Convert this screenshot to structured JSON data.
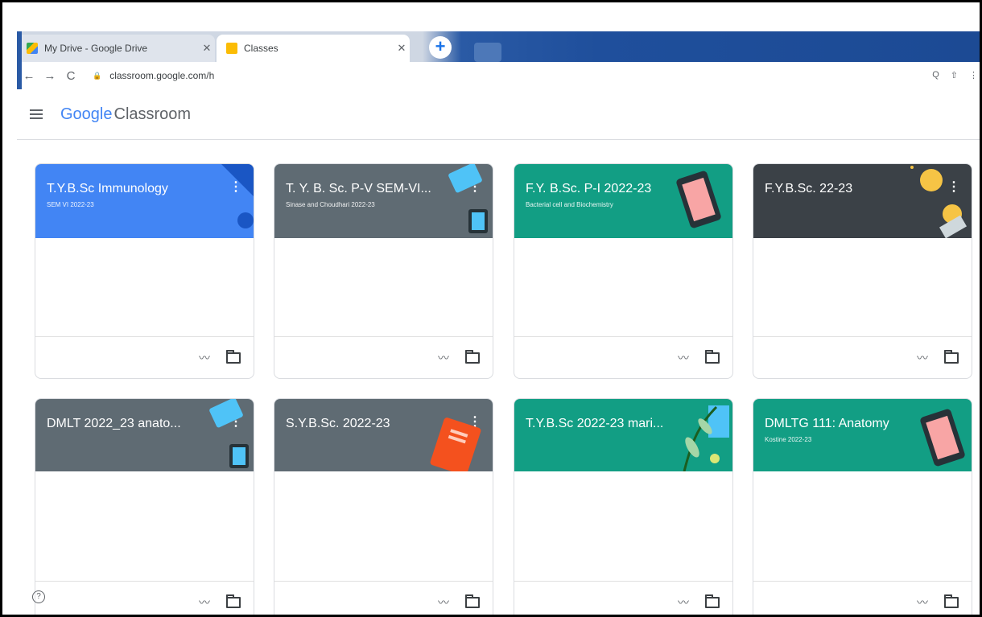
{
  "browser": {
    "tabs": [
      {
        "title": "My Drive - Google Drive",
        "close": "✕",
        "active": false
      },
      {
        "title": "Classes",
        "close": "✕",
        "active": true
      }
    ],
    "new_tab_label": "+",
    "url": "classroom.google.com/h",
    "nav": {
      "back": "←",
      "forward": "→",
      "reload": "C"
    },
    "right_icons": [
      "Q",
      "⇧",
      "⋮"
    ]
  },
  "app": {
    "brand_google": "Google",
    "brand_product": "Classroom"
  },
  "classes": [
    {
      "title": "T.Y.B.Sc Immunology",
      "subtitle": "SEM VI 2022-23",
      "color": "#4285f4"
    },
    {
      "title": "T. Y. B. Sc. P-V SEM-VI...",
      "subtitle": "Sinase and Choudhari 2022-23",
      "color": "#5f6b73"
    },
    {
      "title": "F.Y. B.Sc. P-I 2022-23",
      "subtitle": "Bacterial cell and Biochemistry",
      "color": "#129e84"
    },
    {
      "title": "F.Y.B.Sc. 22-23",
      "subtitle": "",
      "color": "#3b4147"
    },
    {
      "title": "DMLT 2022_23 anato...",
      "subtitle": "",
      "color": "#5f6b73"
    },
    {
      "title": "S.Y.B.Sc. 2022-23",
      "subtitle": "",
      "color": "#5f6b73"
    },
    {
      "title": "T.Y.B.Sc 2022-23 mari...",
      "subtitle": "",
      "color": "#129e84"
    },
    {
      "title": "DMLTG 111: Anatomy",
      "subtitle": "Kostine 2022-23",
      "color": "#129e84"
    }
  ],
  "card_icons": {
    "trend": "trend-icon",
    "folder": "folder-icon"
  },
  "help_label": "?"
}
